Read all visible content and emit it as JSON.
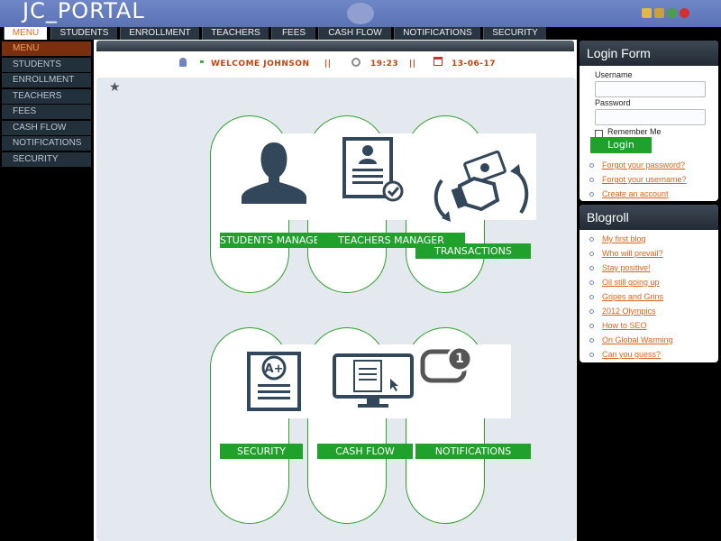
{
  "app": {
    "title": "JC_PORTAL"
  },
  "topnav": {
    "tabs": [
      "MENU",
      "STUDENTS",
      "ENROLLMENT",
      "TEACHERS",
      "FEES",
      "CASH FLOW",
      "NOTIFICATIONS",
      "SECURITY"
    ]
  },
  "sidebar": {
    "items": [
      "MENU",
      "STUDENTS",
      "ENROLLMENT",
      "TEACHERS",
      "FEES",
      "CASH FLOW",
      "NOTIFICATIONS",
      "SECURITY"
    ]
  },
  "welcome": {
    "greeting": "WELCOME JOHNSON",
    "separator": "||",
    "time": "19:23",
    "date": "13-06-17"
  },
  "dashboard": {
    "tiles": [
      {
        "label": "STUDENTS MANAGER",
        "icon": "student-icon"
      },
      {
        "label": "TEACHERS MANAGER",
        "icon": "teacher-document-icon"
      },
      {
        "label": "TRANSACTIONS",
        "icon": "money-transfer-icon"
      },
      {
        "label": "SECURITY",
        "icon": "grade-document-icon"
      },
      {
        "label": "CASH FLOW",
        "icon": "monitor-icon"
      },
      {
        "label": "NOTIFICATIONS",
        "icon": "notification-icon",
        "badge": "1"
      }
    ]
  },
  "login": {
    "title": "Login Form",
    "username_label": "Username",
    "password_label": "Password",
    "username_value": "",
    "password_value": "",
    "remember_label": "Remember Me",
    "button_label": "Login",
    "links": [
      "Forgot your password?",
      "Forgot your username?",
      "Create an account"
    ]
  },
  "blogroll": {
    "title": "Blogroll",
    "links": [
      "My first blog",
      "Who will prevail?",
      "Stay positive!",
      "Oil still going up",
      "Gripes and Grins",
      "2012 Olympics",
      "How to SEO",
      "On Global Warming",
      "Can you guess?"
    ]
  },
  "colors": {
    "accent_green": "#1fa12c",
    "link_orange": "#e0641c",
    "header_blue": "#6479bd"
  }
}
